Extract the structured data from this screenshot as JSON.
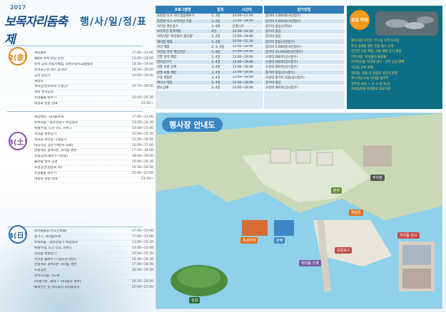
{
  "logo": {
    "year": "2017",
    "name": "보목자리돔축제",
    "sub": "축제"
  },
  "page_title": "행/사/일/정/표",
  "days": [
    {
      "label": "2(金)",
      "color": "#d9871c",
      "events": [
        {
          "name": "개막통보",
          "time": "17:00~14:00"
        },
        {
          "name": "제8회 보목 마당 운영",
          "time": "13:00~19:00"
        },
        {
          "name": "보목 잠의 자동차체험, 보목초중학교품질회",
          "time": "18:30~19:00"
        },
        {
          "name": "보목포구와 맨스 포시아",
          "time": "18:30~19:00"
        },
        {
          "name": "공연 봉산기",
          "time": "19:00~19:00"
        },
        {
          "name": "개막식",
          "time": ""
        },
        {
          "name": "개막공연(마소의 무용단)",
          "time": "19:70~20:00"
        },
        {
          "name": "개막 축하공연",
          "time": ""
        },
        {
          "name": "소망불꽃 띄우기",
          "time": "20:00~20:30"
        },
        {
          "name": "내일의 일정 안내",
          "time": "21:00~"
        }
      ]
    },
    {
      "label": "3(土)",
      "color": "#8a4fa6",
      "events": [
        {
          "name": "희망체조, 자리돔축제",
          "time": "17:00~12:00"
        },
        {
          "name": "보목마을 : 광산검정기 특집행사",
          "time": "13:00~19:30"
        },
        {
          "name": "특별부대, 도전 나도 가수다",
          "time": "14:00~15:00"
        },
        {
          "name": "지리돔 맨손잡기",
          "time": "15:00~15:30"
        },
        {
          "name": "서귀포 야시장 기세잡기",
          "time": "15:30~16:00"
        },
        {
          "name": "대치시장 공연 (어린이 대회)",
          "time": "16:00~17:00"
        },
        {
          "name": "관광객과 함께하는 자리돔 경연",
          "time": "17:00~18:00"
        },
        {
          "name": "초청공연(해녀가 시낭송)",
          "time": "18:00~19:00"
        },
        {
          "name": "솔바람 영어 공연",
          "time": "19:00~19:30"
        },
        {
          "name": "초청공연(김승희 외)",
          "time": "19:30~20:00"
        },
        {
          "name": "소망불꽃 띄우기",
          "time": "20:00~21:00"
        },
        {
          "name": "내일의 일정 안내",
          "time": "21:00~"
        }
      ]
    },
    {
      "label": "4(日)",
      "color": "#2a6fae",
      "events": [
        {
          "name": "보목불볼걷기(도전마을)",
          "time": "17:00~15:00"
        },
        {
          "name": "용기기, 자리돔축제",
          "time": "17:00~12:00"
        },
        {
          "name": "보목마을 : 광산검정기 특집행사",
          "time": "13:00~19:30"
        },
        {
          "name": "특별부대, 도전 나도 가수다",
          "time": "14:00~15:00"
        },
        {
          "name": "자리돔 맨손잡기",
          "time": "15:00~15:30"
        },
        {
          "name": "우리동 줄여주기 (청소년 경연)",
          "time": "16:30~16:30"
        },
        {
          "name": "관광객과 함께하는 자리돔 경연",
          "time": "17:00~18:00"
        },
        {
          "name": "초청공연",
          "time": "18:30~19:30"
        },
        {
          "name": "보목자리돔 기도제",
          "time": ""
        },
        {
          "name": "(축제기본, 해녀 ~ 자리돔의 외수)",
          "time": "19:30~20:00"
        },
        {
          "name": "폐막선언 및 자리돔지 자리돔축하",
          "time": "20:00~21:00"
        }
      ]
    }
  ],
  "program_table": {
    "headers": [
      "프로그램명",
      "일정",
      "시간대"
    ],
    "rows": [
      [
        "조랑말 타고 자리 탑승해보기",
        "2, 3일",
        "20:00~21:00"
      ],
      [
        "통통배 타고 보목바당 유람",
        "3, 4일",
        "12:00~18:00"
      ],
      [
        "자리돔 맨손잡기",
        "3, 4일",
        "운영시간"
      ],
      [
        "보목퓨전 창작체험",
        "4일",
        "12:00~14:30"
      ],
      [
        "가족사랑 \"바닷물이 물방울\"",
        "3, 4일",
        "12:00~18:00"
      ],
      [
        "해녀일 체험",
        "3, 4일",
        "14:00~15:30"
      ],
      [
        "카약 체험",
        "2, 3, 4일",
        "12:00~18:00"
      ],
      [
        "자리돔 바이 해상전달",
        "3, 4일",
        "11:00~14:00"
      ],
      [
        "전통 승마 체험",
        "3, 4일",
        "12:00~18:00"
      ],
      [
        "잡아당기기",
        "3, 4일",
        "12:00~18:00"
      ],
      [
        "전통 씨름 상계",
        "3, 4일",
        "12:00~18:00"
      ],
      [
        "순발 씨름 체험",
        "3, 4일",
        "12:00~18:00"
      ],
      [
        "수중 체험존",
        "3, 4일",
        "12:00~18:00"
      ],
      [
        "해녀소 체험",
        "3, 4일",
        "12:00~18:00"
      ],
      [
        "판도삼체",
        "3, 4일",
        "12:00~18:00"
      ]
    ]
  },
  "fee_table": {
    "headers": [
      "참가방법"
    ],
    "rows": [
      [
        "참가비 3,000원(사전접수)"
      ],
      [
        "참가비 5,000원(사전접수)"
      ],
      [
        "참가비 없음(선착순)"
      ],
      [
        "참가비 없음"
      ],
      [
        "참가비 없음"
      ],
      [
        "참가비 없음(사전접수)"
      ],
      [
        "참가비 5,000원(사전접수)"
      ],
      [
        "참가비 10,000원(사전접수)"
      ],
      [
        "소정의 재료비(상시접수)"
      ],
      [
        "소정의 재료비(상시접수)"
      ],
      [
        "소정의 재료비(상시접수)"
      ],
      [
        "참가비 없음(상시접수)"
      ],
      [
        "소정의 참가비 있음(상시접수)"
      ],
      [
        "참가비 없음"
      ],
      [
        "소정의 재료비(상시접수)"
      ]
    ]
  },
  "side_panel": {
    "tag": "상설 마당",
    "items": [
      "홍보지원 사진전, 부스정 지역 트로팅",
      "주섯 설레일 판로 인양 돌스 상자",
      "전인양 인팜 체험, 오물 체험 장기 체험",
      "가족사랑 \"바닷물이 물방울\"",
      "지역특산물 직거래 장터 · 지역 농업 판매",
      "지리돔 장류 판매",
      "자리돔, 청종 대 현장의 식당가 운영",
      "푸드마당 소방 자리돔 협력부",
      "경주일 (9일 ~ 시 시 점 특선)",
      "자리돔축제 자리판로 의료지원"
    ]
  },
  "map": {
    "title": "행사장 안내도",
    "labels": [
      "특설무대",
      "판매",
      "본부",
      "보목포구",
      "자리돔 가게",
      "주차장",
      "섶섬",
      "자리돔 전시",
      "체험존"
    ]
  }
}
